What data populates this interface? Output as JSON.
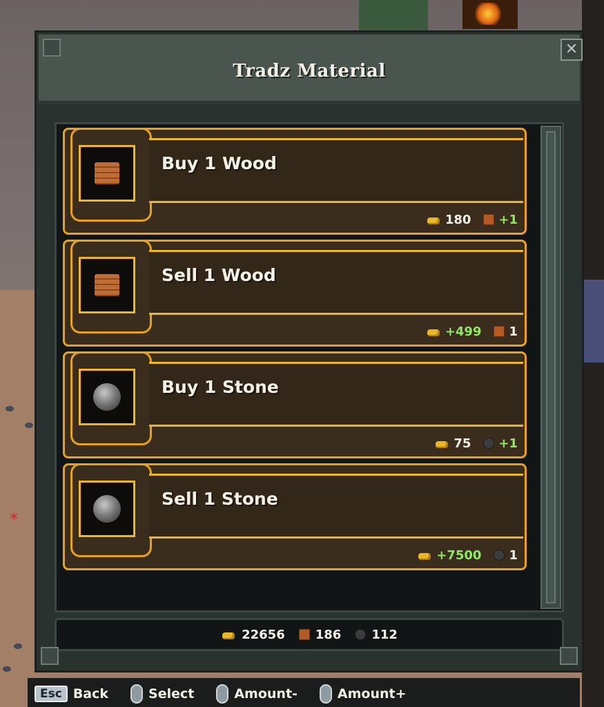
{
  "window": {
    "title": "Tradz Material",
    "close_label": "✕"
  },
  "trade_items": [
    {
      "label": "Buy 1 Wood",
      "material": "wood",
      "gold": "180",
      "gold_gain": false,
      "material_amount": "+1",
      "material_gain": true
    },
    {
      "label": "Sell 1 Wood",
      "material": "wood",
      "gold": "+499",
      "gold_gain": true,
      "material_amount": "1",
      "material_gain": false
    },
    {
      "label": "Buy 1 Stone",
      "material": "stone",
      "gold": "75",
      "gold_gain": false,
      "material_amount": "+1",
      "material_gain": true
    },
    {
      "label": "Sell 1 Stone",
      "material": "stone",
      "gold": "+7500",
      "gold_gain": true,
      "material_amount": "1",
      "material_gain": false
    }
  ],
  "inventory": {
    "gold": "22656",
    "wood": "186",
    "stone": "112"
  },
  "controls": [
    {
      "key": "Esc",
      "label": "Back"
    },
    {
      "icon": "mouse-left-icon",
      "label": "Select"
    },
    {
      "icon": "mouse-scroll-icon",
      "label": "Amount-"
    },
    {
      "icon": "mouse-right-icon",
      "label": "Amount+"
    }
  ],
  "colors": {
    "gold_border": "#e8a21c",
    "gain_text": "#8dea61",
    "panel_bg": "#2a322f"
  }
}
